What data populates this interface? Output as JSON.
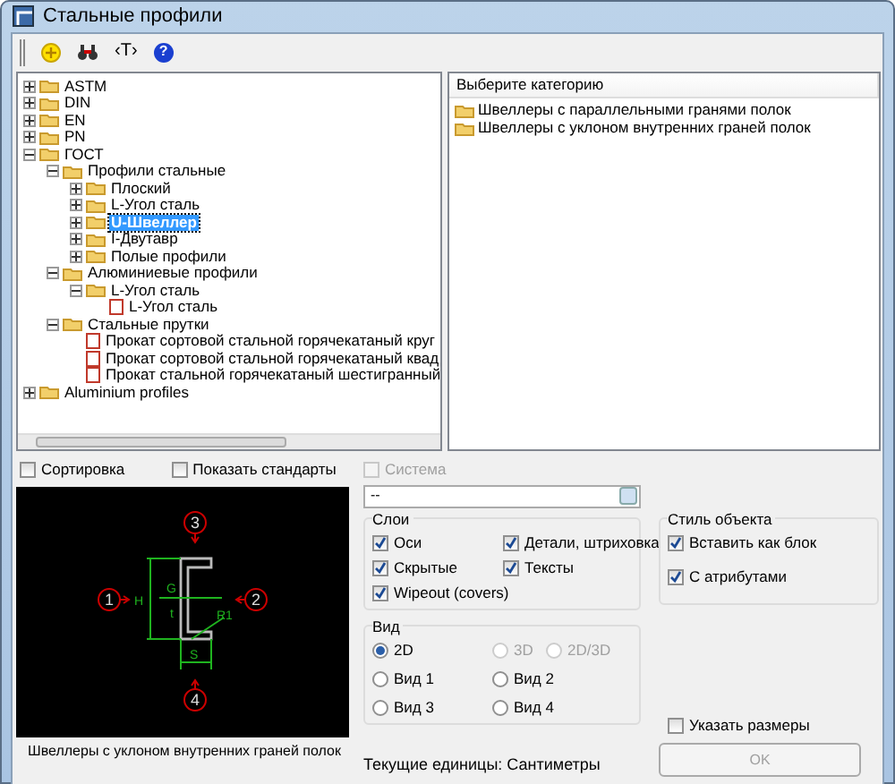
{
  "window": {
    "title": "Стальные профили"
  },
  "toolbar": [
    {
      "kind": "add"
    },
    {
      "kind": "find"
    },
    {
      "kind": "text",
      "label": "‹T›"
    },
    {
      "kind": "help",
      "label": "?"
    }
  ],
  "tree": [
    {
      "label": "ASTM",
      "kind": "folder",
      "expanded": false,
      "selected": false
    },
    {
      "label": "DIN",
      "kind": "folder",
      "expanded": false,
      "selected": false
    },
    {
      "label": "EN",
      "kind": "folder",
      "expanded": false,
      "selected": false
    },
    {
      "label": "PN",
      "kind": "folder",
      "expanded": false,
      "selected": false
    },
    {
      "label": "ГОСТ",
      "kind": "folder",
      "expanded": true,
      "selected": false,
      "children": [
        {
          "label": "Профили стальные",
          "kind": "folder",
          "expanded": true,
          "selected": false,
          "children": [
            {
              "label": "Плоский",
              "kind": "folder",
              "expanded": false,
              "selected": false
            },
            {
              "label": "L-Угол сталь",
              "kind": "folder",
              "expanded": false,
              "selected": false
            },
            {
              "label": "U-Швеллер",
              "kind": "folder",
              "expanded": false,
              "selected": true
            },
            {
              "label": "I-Двутавр",
              "kind": "folder",
              "expanded": false,
              "selected": false
            },
            {
              "label": "Полые профили",
              "kind": "folder",
              "expanded": false,
              "selected": false
            }
          ]
        },
        {
          "label": "Алюминиевые профили",
          "kind": "folder",
          "expanded": true,
          "selected": false,
          "children": [
            {
              "label": "L-Угол сталь",
              "kind": "folder",
              "expanded": true,
              "selected": false,
              "children": [
                {
                  "label": "L-Угол сталь",
                  "kind": "item",
                  "selected": false
                }
              ]
            }
          ]
        },
        {
          "label": "Стальные прутки",
          "kind": "folder",
          "expanded": true,
          "selected": false,
          "children": [
            {
              "label": "Прокат сортовой стальной горячекатаный круг",
              "kind": "item",
              "selected": false
            },
            {
              "label": "Прокат сортовой стальной горячекатаный квад",
              "kind": "item",
              "selected": false
            },
            {
              "label": "Прокат стальной горячекатаный шестигранный",
              "kind": "item",
              "selected": false
            }
          ]
        }
      ]
    },
    {
      "label": "Aluminium profiles",
      "kind": "folder",
      "expanded": false,
      "selected": false
    }
  ],
  "category_list": {
    "header": "Выберите категорию",
    "items": [
      {
        "label": "Швеллеры с параллельными гранями полок"
      },
      {
        "label": "Швеллеры с уклоном внутренних граней полок"
      }
    ]
  },
  "options": [
    {
      "label": "Сортировка",
      "checked": false
    },
    {
      "label": "Показать стандарты",
      "checked": false
    }
  ],
  "preview": {
    "callouts": [
      "3",
      "1",
      "2",
      "4"
    ],
    "dimension_labels": [
      "H",
      "G",
      "t",
      "S",
      "R1"
    ],
    "caption": "Швеллеры с уклоном внутренних граней полок"
  },
  "system": {
    "label": "Система",
    "checked": false,
    "disabled": true
  },
  "dropdown": {
    "value": "--"
  },
  "layers": {
    "title": "Слои",
    "items": [
      {
        "label": "Оси",
        "checked": true
      },
      {
        "label": "Детали, штриховка",
        "checked": true
      },
      {
        "label": "Скрытые",
        "checked": true
      },
      {
        "label": "Тексты",
        "checked": true
      },
      {
        "label": "Wipeout (covers)",
        "checked": true
      }
    ]
  },
  "view": {
    "title": "Вид",
    "rows": [
      [
        {
          "label": "2D",
          "selected": true,
          "disabled": false
        },
        {
          "label": "3D",
          "selected": false,
          "disabled": true
        },
        {
          "label": "2D/3D",
          "selected": false,
          "disabled": true
        }
      ],
      [
        {
          "label": "Вид 1",
          "selected": false,
          "disabled": false
        },
        {
          "label": "Вид 2",
          "selected": false,
          "disabled": false
        }
      ],
      [
        {
          "label": "Вид 3",
          "selected": false,
          "disabled": false
        },
        {
          "label": "Вид 4",
          "selected": false,
          "disabled": false
        }
      ]
    ]
  },
  "object_style": {
    "title": "Стиль объекта",
    "items": [
      {
        "label": "Вставить как блок",
        "checked": true
      },
      {
        "label": "С атрибутами",
        "checked": true
      }
    ]
  },
  "specify_sizes": {
    "label": "Указать размеры",
    "checked": false
  },
  "units": "Текущие единицы: Сантиметры",
  "ok_button": {
    "label": "OK",
    "disabled": true
  }
}
